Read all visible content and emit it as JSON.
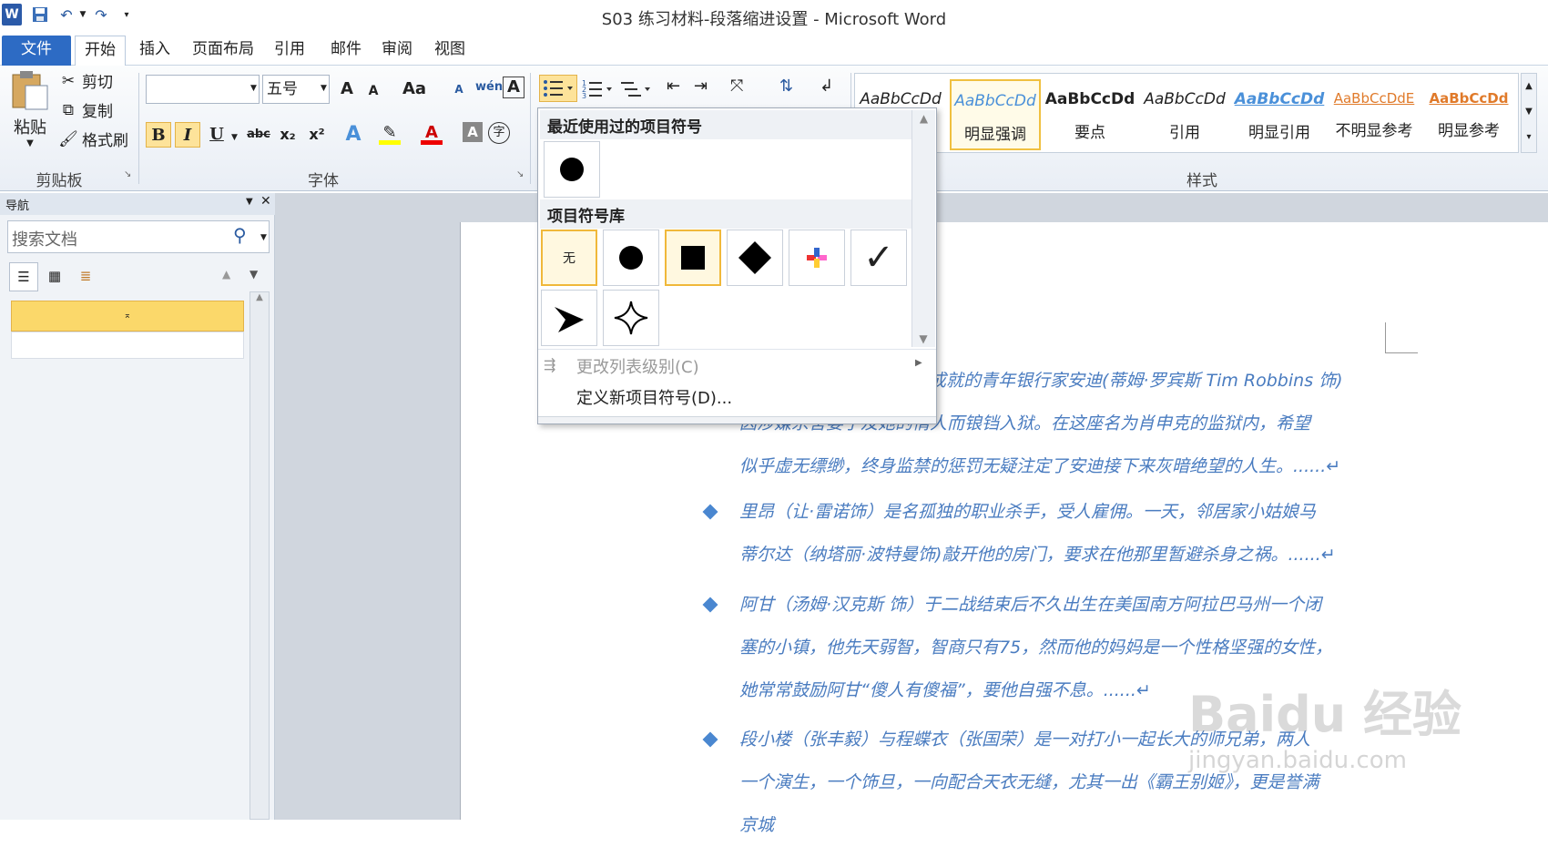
{
  "window": {
    "title": "S03 练习材料-段落缩进设置 - Microsoft Word"
  },
  "tabs": [
    "文件",
    "开始",
    "插入",
    "页面布局",
    "引用",
    "邮件",
    "审阅",
    "视图"
  ],
  "clipboard": {
    "paste": "粘贴",
    "cut": "剪切",
    "copy": "复制",
    "format_painter": "格式刷",
    "label": "剪贴板"
  },
  "font": {
    "name_value": "",
    "size_value": "五号",
    "label": "字体",
    "bold": "B",
    "italic": "I",
    "underline": "U",
    "strike": "abc",
    "sub": "x₂",
    "sup": "x²",
    "grow": "A",
    "shrink": "A",
    "case": "Aa",
    "pinyin": "wén",
    "border": "A",
    "clear": "A",
    "enclose": "字"
  },
  "styles": {
    "label": "样式",
    "items": [
      {
        "preview": "AaBbCcDd",
        "name": ""
      },
      {
        "preview": "AaBbCcDd",
        "name": "明显强调"
      },
      {
        "preview": "AaBbCcDd",
        "name": "要点"
      },
      {
        "preview": "AaBbCcDd",
        "name": "引用"
      },
      {
        "preview": "AaBbCcDd",
        "name": "明显引用"
      },
      {
        "preview": "AaBbCcDdE",
        "name": "不明显参考"
      },
      {
        "preview": "AaBbCcDd",
        "name": "明显参考"
      }
    ]
  },
  "nav": {
    "title": "导航",
    "search_placeholder": "搜索文档"
  },
  "bullet_menu": {
    "recent_header": "最近使用过的项目符号",
    "library_header": "项目符号库",
    "none_label": "无",
    "change_level": "更改列表级别(C)",
    "define_new": "定义新项目符号(D)..."
  },
  "document": {
    "paragraphs": [
      {
        "lines": [
          "成就的青年银行家安迪(蒂姆·罗宾斯 Tim Robbins 饰)",
          "因涉嫌杀害妻子及她的情人而锒铛入狱。在这座名为肖申克的监狱内，希望",
          "似乎虚无缥缈，终身监禁的惩罚无疑注定了安迪接下来灰暗绝望的人生。......↵"
        ]
      },
      {
        "lines": [
          "里昂（让·雷诺饰）是名孤独的职业杀手，受人雇佣。一天，邻居家小姑娘马",
          "蒂尔达（纳塔丽·波特曼饰)敲开他的房门，要求在他那里暂避杀身之祸。......↵"
        ]
      },
      {
        "lines": [
          "阿甘（汤姆·汉克斯 饰）于二战结束后不久出生在美国南方阿拉巴马州一个闭",
          "塞的小镇，他先天弱智，智商只有75，然而他的妈妈是一个性格坚强的女性，",
          "她常常鼓励阿甘“傻人有傻福”，要他自强不息。......↵"
        ]
      },
      {
        "lines": [
          "段小楼（张丰毅）与程蝶衣（张国荣）是一对打小一起长大的师兄弟，两人",
          "一个演生，一个饰旦，一向配合天衣无缝，尤其一出《霸王别姬》，更是誉满",
          "京城"
        ]
      }
    ]
  },
  "watermark": {
    "brand": "Baidu 经验",
    "url": "jingyan.baidu.com"
  },
  "colors": {
    "file_tab": "#2d6bc4",
    "accent_text": "#4a7cc0",
    "highlight": "#fde39a"
  }
}
